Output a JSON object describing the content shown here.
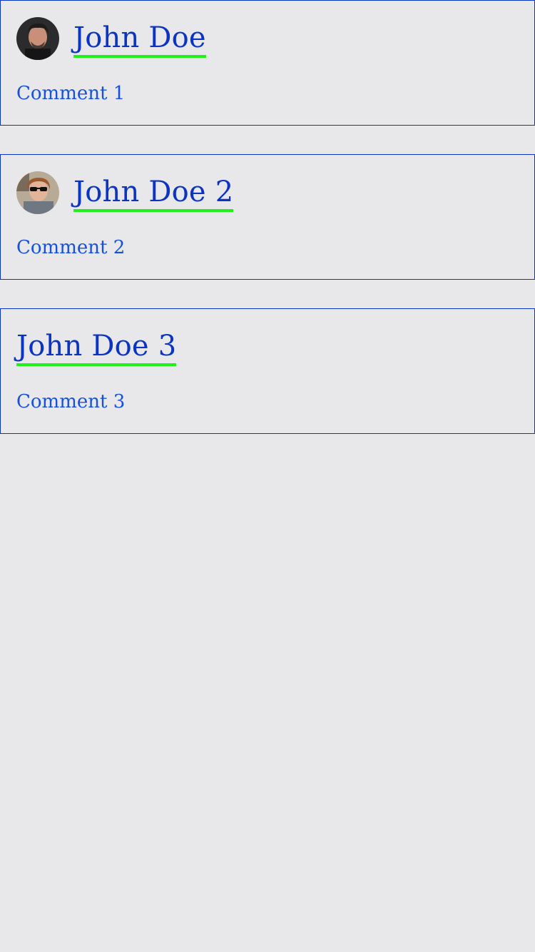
{
  "comments": [
    {
      "author": "John Doe",
      "text": "Comment 1",
      "avatar_icon": "avatar-dark-hair-man"
    },
    {
      "author": "John Doe 2",
      "text": "Comment 2",
      "avatar_icon": "avatar-sunglasses-man"
    },
    {
      "author": "John Doe 3",
      "text": "Comment 3"
    }
  ],
  "colors": {
    "background": "#e8e8ea",
    "border": "#0b34c2",
    "link": "#0b34c2",
    "link_underline": "#1ef21a",
    "comment_text": "#1650dd"
  }
}
